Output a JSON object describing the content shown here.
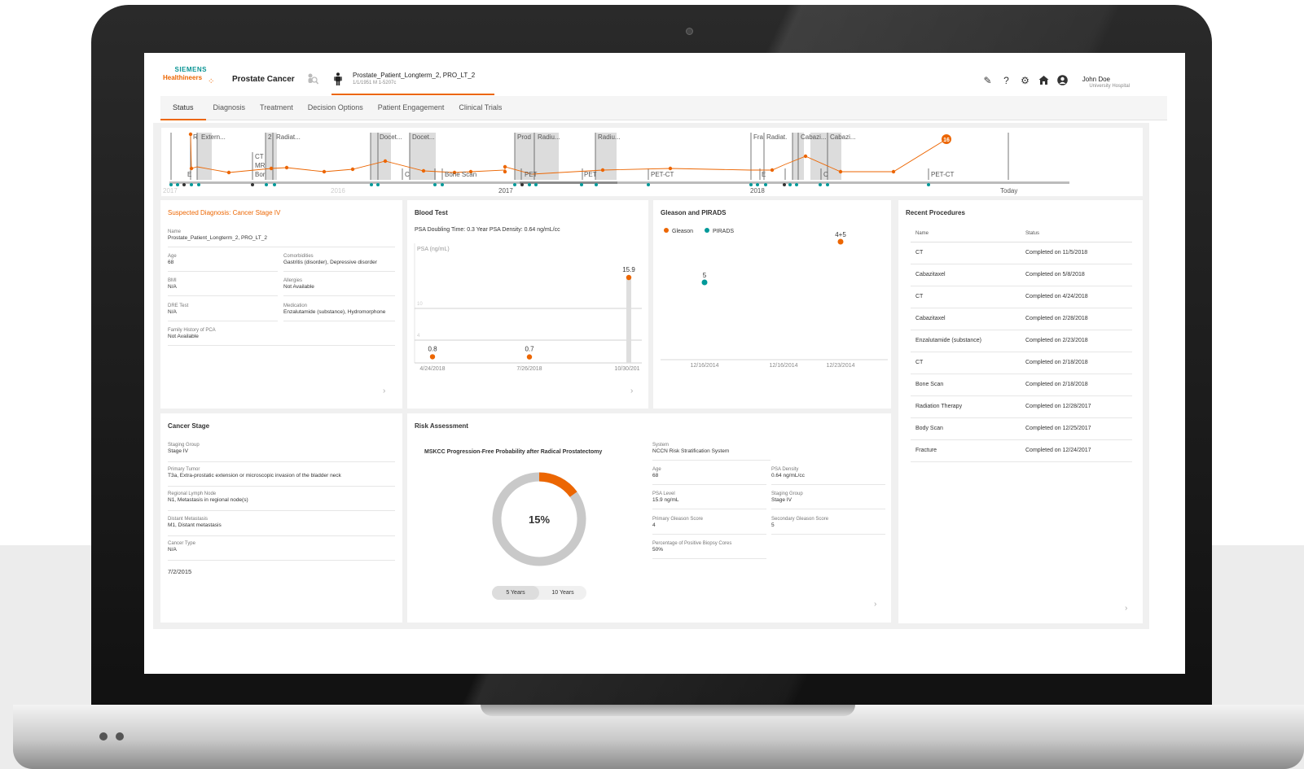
{
  "header": {
    "logo_line1": "SIEMENS",
    "logo_line2": "Healthineers",
    "app_title": "Prostate Cancer",
    "patient_name": "Prostate_Patient_Longterm_2, PRO_LT_2",
    "patient_sub": "1/1/1951 M 1-5207c",
    "user_name": "John Doe",
    "user_org": "University Hospital",
    "icons": [
      "edit-icon",
      "help-icon",
      "settings-icon",
      "home-icon",
      "user-icon"
    ]
  },
  "tabs": [
    "Status",
    "Diagnosis",
    "Treatment",
    "Decision Options",
    "Patient Engagement",
    "Clinical Trials"
  ],
  "timeline": {
    "year_labels": [
      "2017",
      "2018",
      "Today"
    ],
    "faded_year_labels": [
      "2017",
      "2016"
    ],
    "events": [
      "R",
      "Extern...",
      "2",
      "Radiat...",
      "CT",
      "MR",
      "Bor",
      "Docet...",
      "Docet...",
      "Prod",
      "Radiu...",
      "Radiu...",
      "Fra",
      "Radiat.",
      "Cabazi...",
      "Cabazi...",
      "Bone Scan",
      "PET",
      "PET",
      "PET-CT",
      "PET-CT",
      "C",
      "C",
      "E",
      "E"
    ],
    "badge": "16"
  },
  "diagnosis_card": {
    "title": "Suspected Diagnosis: Cancer Stage IV",
    "fields": [
      {
        "label": "Name",
        "value": "Prostate_Patient_Longterm_2, PRO_LT_2"
      },
      {
        "label": "Age",
        "value": "68"
      },
      {
        "label": "Comorbidities",
        "value": "Gastritis (disorder), Depressive disorder"
      },
      {
        "label": "BMI",
        "value": "N/A"
      },
      {
        "label": "Allergies",
        "value": "Not Available"
      },
      {
        "label": "DRE Test",
        "value": "N/A"
      },
      {
        "label": "Medication",
        "value": "Enzalutamide (substance), Hydromorphone"
      },
      {
        "label": "Family History of PCA",
        "value": "Not Available"
      }
    ]
  },
  "blood_test": {
    "title": "Blood Test",
    "summary": "PSA Doubling Time: 0.3 Year   PSA Density: 0.64 ng/mL/cc",
    "y_unit": "PSA (ng/mL)",
    "gridline_labels": [
      "10",
      "4"
    ],
    "points": [
      {
        "date": "4/24/2018",
        "value": 0.8,
        "label": "0.8"
      },
      {
        "date": "7/26/2018",
        "value": 0.7,
        "label": "0.7"
      },
      {
        "date": "10/30/2018",
        "value": 15.9,
        "label": "15.9"
      }
    ],
    "x_labels": [
      "4/24/2018",
      "7/26/2018",
      "10/30/201"
    ]
  },
  "gleason": {
    "title": "Gleason and PIRADS",
    "legend": [
      {
        "name": "Gleason",
        "color": "#ec6602"
      },
      {
        "name": "PIRADS",
        "color": "#009999"
      }
    ],
    "points": [
      {
        "series": "PIRADS",
        "date": "12/16/2014",
        "label": "5"
      },
      {
        "series": "Gleason",
        "date": "12/23/2014",
        "label": "4+5"
      }
    ],
    "x_labels": [
      "12/16/2014",
      "12/16/2014",
      "12/23/2014"
    ]
  },
  "recent_procedures": {
    "title": "Recent Procedures",
    "col_name": "Name",
    "col_status": "Status",
    "rows": [
      {
        "name": "CT",
        "status": "Completed on 11/5/2018"
      },
      {
        "name": "Cabazitaxel",
        "status": "Completed on 5/8/2018"
      },
      {
        "name": "CT",
        "status": "Completed on 4/24/2018"
      },
      {
        "name": "Cabazitaxel",
        "status": "Completed on 2/28/2018"
      },
      {
        "name": "Enzalutamide (substance)",
        "status": "Completed on 2/23/2018"
      },
      {
        "name": "CT",
        "status": "Completed on 2/18/2018"
      },
      {
        "name": "Bone Scan",
        "status": "Completed on 2/18/2018"
      },
      {
        "name": "Radiation Therapy",
        "status": "Completed on 12/28/2017"
      },
      {
        "name": "Body Scan",
        "status": "Completed on 12/25/2017"
      },
      {
        "name": "Fracture",
        "status": "Completed on 12/24/2017"
      }
    ]
  },
  "cancer_stage": {
    "title": "Cancer Stage",
    "fields": [
      {
        "label": "Staging Group",
        "value": "Stage IV"
      },
      {
        "label": "Primary Tumor",
        "value": "T3a, Extra-prostatic extension or microscopic invasion of the bladder neck"
      },
      {
        "label": "Regional Lymph Node",
        "value": "N1, Metastasis in regional node(s)"
      },
      {
        "label": "Distant Metastasis",
        "value": "M1, Distant metastasis"
      },
      {
        "label": "Cancer Type",
        "value": "N/A"
      }
    ],
    "date": "7/2/2015"
  },
  "risk": {
    "title": "Risk Assessment",
    "model_title": "MSKCC Progression-Free Probability after Radical Prostatectomy",
    "percent_label": "15%",
    "percent_value": 15,
    "years": [
      "5 Years",
      "10 Years"
    ],
    "fields": [
      {
        "label": "System",
        "value": "NCCN Risk Stratification System"
      },
      {
        "label": "Age",
        "value": "68"
      },
      {
        "label": "PSA Density",
        "value": "0.64 ng/mL/cc"
      },
      {
        "label": "PSA Level",
        "value": "15.9 ng/mL"
      },
      {
        "label": "Staging Group",
        "value": "Stage IV"
      },
      {
        "label": "Primary Gleason Score",
        "value": "4"
      },
      {
        "label": "Secondary Gleason Score",
        "value": "5"
      },
      {
        "label": "Percentage of Positive Biopsy Cores",
        "value": "50%"
      }
    ]
  },
  "colors": {
    "accent": "#ec6602",
    "teal": "#009999",
    "brand_teal": "#0a9494"
  }
}
